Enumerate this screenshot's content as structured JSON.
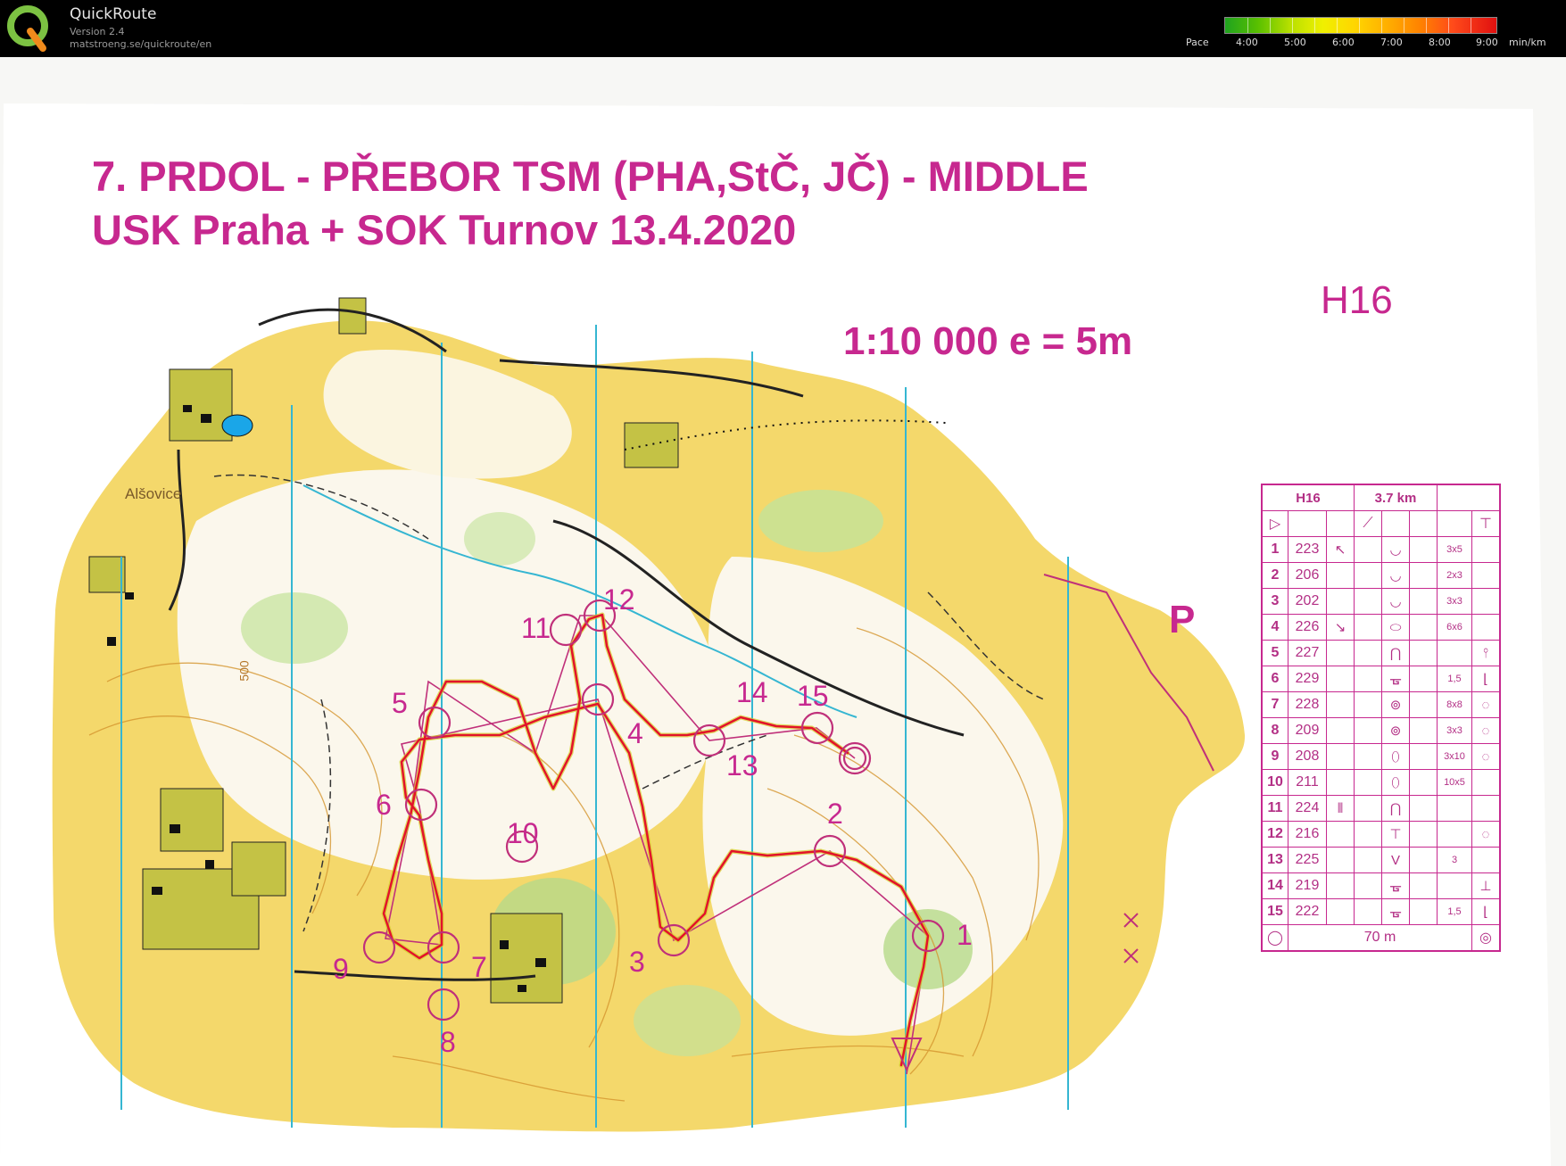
{
  "app": {
    "name": "QuickRoute",
    "version": "Version 2.4",
    "url": "matstroeng.se/quickroute/en"
  },
  "pace_scale": {
    "label": "Pace",
    "ticks": [
      "4:00",
      "5:00",
      "6:00",
      "7:00",
      "8:00",
      "9:00"
    ],
    "unit": "min/km"
  },
  "map": {
    "title_line1": "7. PRDOL - PŘEBOR TSM (PHA,StČ, JČ) - MIDDLE",
    "title_line2": "USK Praha + SOK Turnov 13.4.2020",
    "scale": "1:10 000   e = 5m",
    "category": "H16",
    "parking": "P",
    "town": "Alšovice",
    "contour_label": "500",
    "control_labels": [
      "1",
      "2",
      "3",
      "4",
      "5",
      "6",
      "7",
      "8",
      "9",
      "10",
      "11",
      "12",
      "13",
      "14",
      "15"
    ]
  },
  "description_sheet": {
    "category": "H16",
    "length": "3.7 km",
    "start_symbol": "▷",
    "start_desc": "⟋",
    "start_extra": "⊤",
    "rows": [
      {
        "num": "1",
        "code": "223",
        "dir": "↖",
        "feature": "◡",
        "dim": "3x5",
        "extra": ""
      },
      {
        "num": "2",
        "code": "206",
        "dir": "",
        "feature": "◡",
        "dim": "2x3",
        "extra": ""
      },
      {
        "num": "3",
        "code": "202",
        "dir": "",
        "feature": "◡",
        "dim": "3x3",
        "extra": ""
      },
      {
        "num": "4",
        "code": "226",
        "dir": "↘",
        "feature": "⬭",
        "dim": "6x6",
        "extra": ""
      },
      {
        "num": "5",
        "code": "227",
        "dir": "",
        "feature": "⋂",
        "dim": "",
        "extra": "⫯"
      },
      {
        "num": "6",
        "code": "229",
        "dir": "",
        "feature": "ᚗ",
        "dim": "1,5",
        "extra": "⌊"
      },
      {
        "num": "7",
        "code": "228",
        "dir": "",
        "feature": "⊚",
        "dim": "8x8",
        "extra": "◌"
      },
      {
        "num": "8",
        "code": "209",
        "dir": "",
        "feature": "⊚",
        "dim": "3x3",
        "extra": "◌"
      },
      {
        "num": "9",
        "code": "208",
        "dir": "",
        "feature": "⬯",
        "dim": "3x10",
        "extra": "◌"
      },
      {
        "num": "10",
        "code": "211",
        "dir": "",
        "feature": "⬯",
        "dim": "10x5",
        "extra": ""
      },
      {
        "num": "11",
        "code": "224",
        "dir": "⫴",
        "feature": "⋂",
        "dim": "",
        "extra": ""
      },
      {
        "num": "12",
        "code": "216",
        "dir": "",
        "feature": "⊤",
        "dim": "",
        "extra": "◌"
      },
      {
        "num": "13",
        "code": "225",
        "dir": "",
        "feature": "V",
        "dim": "3",
        "extra": ""
      },
      {
        "num": "14",
        "code": "219",
        "dir": "",
        "feature": "ᚗ",
        "dim": "",
        "extra": "⊥"
      },
      {
        "num": "15",
        "code": "222",
        "dir": "",
        "feature": "ᚗ",
        "dim": "1,5",
        "extra": "⌊"
      }
    ],
    "finish_distance": "70 m"
  }
}
